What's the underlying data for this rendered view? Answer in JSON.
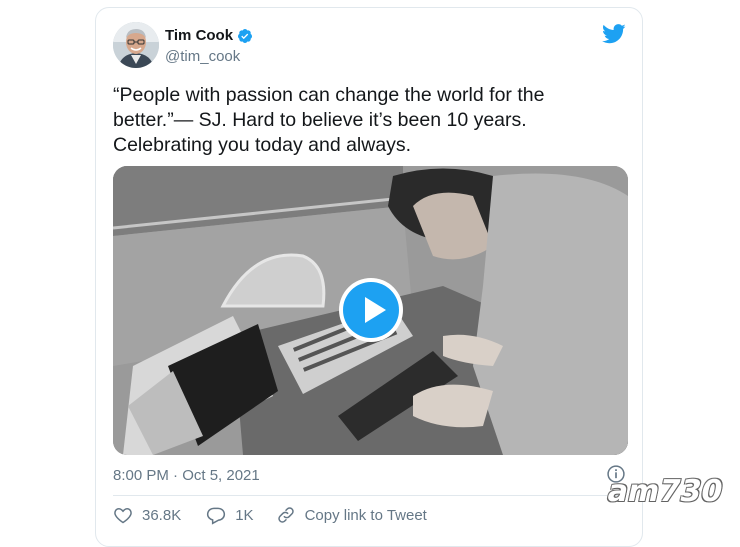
{
  "author": {
    "name": "Tim Cook",
    "handle": "@tim_cook",
    "verified": true
  },
  "tweet": {
    "text_lines": [
      "“People with passion can change the world for the",
      "better.”— SJ. Hard to believe it’s been 10 years.",
      "Celebrating you today and always."
    ],
    "media_type": "video",
    "timestamp": "8:00 PM · Oct 5, 2021"
  },
  "actions": {
    "likes": "36.8K",
    "replies": "1K",
    "copy_link_label": "Copy link to Tweet"
  },
  "icons": {
    "platform": "twitter-bird-icon",
    "verified": "verified-badge-icon",
    "info": "info-icon",
    "like": "heart-icon",
    "reply": "reply-icon",
    "link": "link-icon",
    "play": "play-icon"
  },
  "colors": {
    "twitter_blue": "#1da1f2",
    "text_primary": "#14171a",
    "text_secondary": "#657786",
    "border": "#e1e8ed"
  },
  "watermark": "am730"
}
